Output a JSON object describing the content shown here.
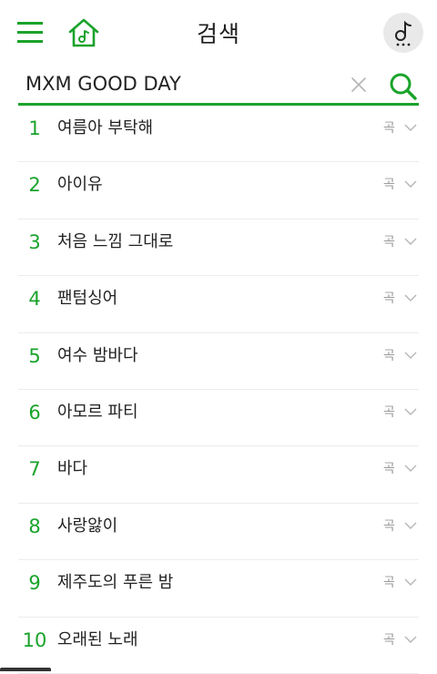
{
  "header": {
    "title": "검색",
    "menu_icon": "hamburger-menu-icon",
    "home_icon": "music-home-icon",
    "music_icon": "music-note-icon"
  },
  "search": {
    "query": "MXM GOOD DAY",
    "clear_icon": "close-icon",
    "search_icon": "search-icon"
  },
  "colors": {
    "accent": "#1aa32b",
    "text": "#222222",
    "muted": "#9a9a9a",
    "divider": "#ececec"
  },
  "suggestions": [
    {
      "rank": "1",
      "text": "여름아 부탁해",
      "type": "곡"
    },
    {
      "rank": "2",
      "text": "아이유",
      "type": "곡"
    },
    {
      "rank": "3",
      "text": "처음 느낌 그대로",
      "type": "곡"
    },
    {
      "rank": "4",
      "text": "팬텀싱어",
      "type": "곡"
    },
    {
      "rank": "5",
      "text": "여수 밤바다",
      "type": "곡"
    },
    {
      "rank": "6",
      "text": "아모르 파티",
      "type": "곡"
    },
    {
      "rank": "7",
      "text": "바다",
      "type": "곡"
    },
    {
      "rank": "8",
      "text": "사랑앓이",
      "type": "곡"
    },
    {
      "rank": "9",
      "text": "제주도의 푸른 밤",
      "type": "곡"
    },
    {
      "rank": "10",
      "text": "오래된 노래",
      "type": "곡"
    }
  ]
}
